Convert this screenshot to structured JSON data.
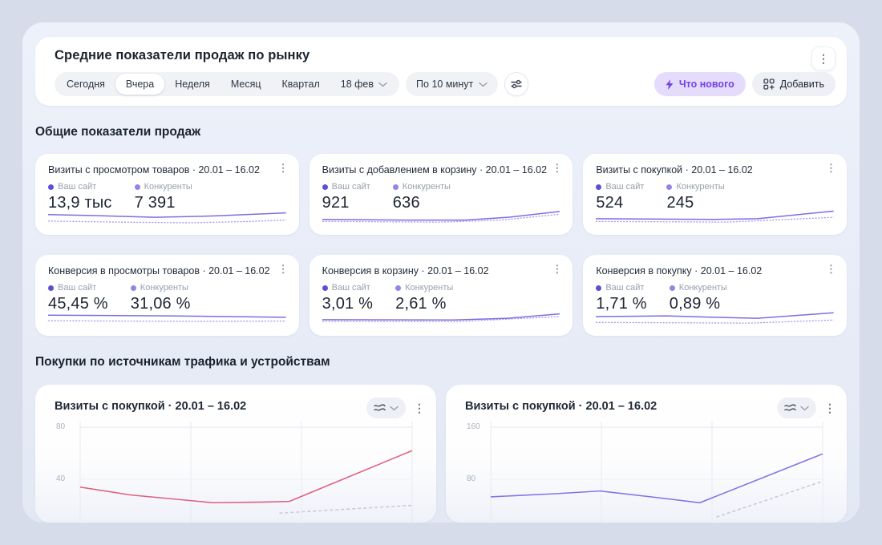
{
  "colors": {
    "accent": "#7440e8",
    "whatsnew_bg": "#e4dcfa",
    "site_dot": "#5a50d8",
    "competitor_dot": "#8f87e8",
    "spark_solid": "#7b6fe0",
    "spark_dashed": "#a49bee",
    "chart1_line": "#e0607e",
    "chart2_line": "#8075e6",
    "competitor_line": "#c6ccd8"
  },
  "header": {
    "title": "Средние показатели продаж по рынку",
    "tabs": [
      "Сегодня",
      "Вчера",
      "Неделя",
      "Месяц",
      "Квартал"
    ],
    "active_tab": "Вчера",
    "date_label": "18 фев",
    "granularity_label": "По 10 минут",
    "whats_new_label": "Что нового",
    "add_label": "Добавить"
  },
  "sections": {
    "overall_title": "Общие показатели продаж",
    "purchases_title": "Покупки по источникам трафика и устройствам"
  },
  "legend": {
    "site": "Ваш сайт",
    "competitors": "Конкуренты"
  },
  "metric_cards": [
    {
      "title": "Визиты с просмотром товаров · 20.01 – 16.02",
      "site_value": "13,9 тыс",
      "competitor_value": "7 391",
      "spark": {
        "site": [
          [
            0,
            9
          ],
          [
            20,
            10.5
          ],
          [
            45,
            13
          ],
          [
            70,
            11
          ],
          [
            100,
            6.5
          ]
        ],
        "competitors": [
          [
            0,
            18.5
          ],
          [
            30,
            20
          ],
          [
            60,
            21
          ],
          [
            85,
            19
          ],
          [
            100,
            17
          ]
        ]
      }
    },
    {
      "title": "Визиты с добавлением в корзину · 20.01 – 16.02",
      "site_value": "921",
      "competitor_value": "636",
      "spark": {
        "site": [
          [
            0,
            16
          ],
          [
            35,
            17
          ],
          [
            60,
            17
          ],
          [
            78,
            13
          ],
          [
            100,
            4.5
          ]
        ],
        "competitors": [
          [
            0,
            19
          ],
          [
            50,
            20
          ],
          [
            75,
            17
          ],
          [
            100,
            8.5
          ]
        ]
      }
    },
    {
      "title": "Визиты с покупкой · 20.01 – 16.02",
      "site_value": "524",
      "competitor_value": "245",
      "spark": {
        "site": [
          [
            0,
            15
          ],
          [
            50,
            16
          ],
          [
            68,
            15
          ],
          [
            100,
            4
          ]
        ],
        "competitors": [
          [
            0,
            19
          ],
          [
            55,
            20
          ],
          [
            100,
            13
          ]
        ]
      }
    },
    {
      "title": "Конверсия в просмотры товаров · 20.01 – 16.02",
      "site_value": "45,45 %",
      "competitor_value": "31,06 %",
      "spark": {
        "site": [
          [
            0,
            8.5
          ],
          [
            50,
            9.5
          ],
          [
            100,
            11.5
          ]
        ],
        "competitors": [
          [
            0,
            16.5
          ],
          [
            60,
            17.5
          ],
          [
            100,
            17
          ]
        ]
      }
    },
    {
      "title": "Конверсия в корзину · 20.01 – 16.02",
      "site_value": "3,01 %",
      "competitor_value": "2,61 %",
      "spark": {
        "site": [
          [
            0,
            15
          ],
          [
            55,
            15.5
          ],
          [
            78,
            13
          ],
          [
            100,
            6.5
          ]
        ],
        "competitors": [
          [
            0,
            17.5
          ],
          [
            55,
            18
          ],
          [
            100,
            10.5
          ]
        ]
      }
    },
    {
      "title": "Конверсия в покупку · 20.01 – 16.02",
      "site_value": "1,71 %",
      "competitor_value": "0,89 %",
      "spark": {
        "site": [
          [
            0,
            10.5
          ],
          [
            30,
            9.5
          ],
          [
            55,
            12
          ],
          [
            68,
            13
          ],
          [
            100,
            5
          ]
        ],
        "competitors": [
          [
            0,
            19
          ],
          [
            65,
            20
          ],
          [
            100,
            15.5
          ]
        ]
      }
    }
  ],
  "chart_data": [
    {
      "type": "line",
      "title": "Визиты с покупкой · 20.01 – 16.02",
      "y_ticks": [
        80,
        40
      ],
      "grid": true,
      "series": [
        {
          "name": "Ваш сайт",
          "color": "#e0607e",
          "dashed": false,
          "x": [
            0,
            15,
            40,
            55,
            63,
            100
          ],
          "values": [
            34,
            28,
            22,
            22.5,
            23,
            62
          ]
        },
        {
          "name": "Конкуренты",
          "color": "#c6ccd8",
          "dashed": true,
          "x": [
            60,
            100
          ],
          "values": [
            14,
            20
          ]
        }
      ]
    },
    {
      "type": "line",
      "title": "Визиты с покупкой · 20.01 – 16.02",
      "y_ticks": [
        160,
        80
      ],
      "grid": true,
      "series": [
        {
          "name": "Ваш сайт",
          "color": "#8075e6",
          "dashed": false,
          "x": [
            0,
            20,
            33,
            50,
            63,
            100
          ],
          "values": [
            53,
            58,
            62,
            52,
            44,
            119
          ]
        },
        {
          "name": "Конкуренты",
          "color": "#c6ccd8",
          "dashed": true,
          "x": [
            68,
            100
          ],
          "values": [
            22,
            77
          ]
        }
      ]
    }
  ]
}
